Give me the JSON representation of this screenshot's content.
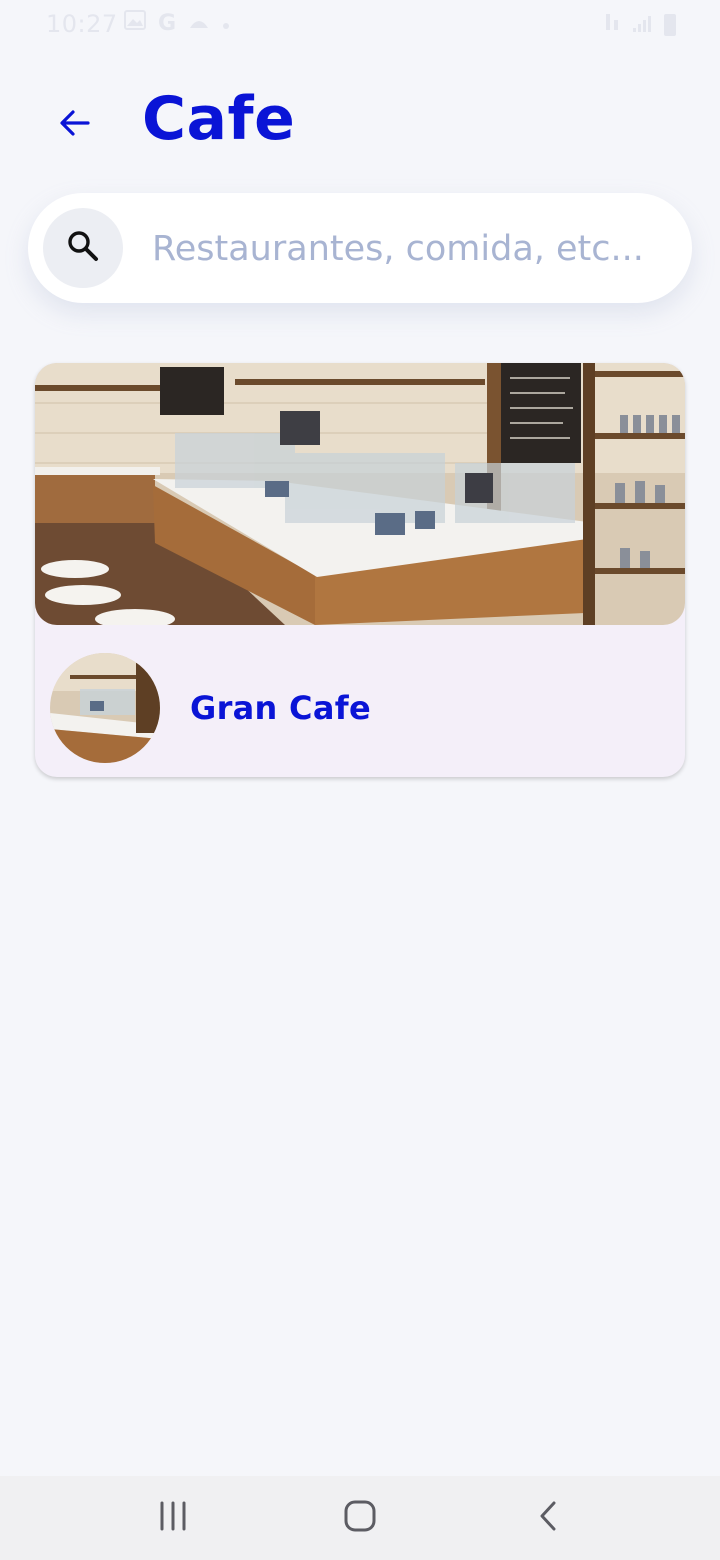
{
  "status_bar": {
    "time": "10:27",
    "left_icons": [
      "gallery-icon",
      "google-icon",
      "weather-icon",
      "dot-icon"
    ],
    "right_icons": [
      "wifi-icon",
      "signal-icon",
      "battery-icon"
    ]
  },
  "header": {
    "back_icon": "arrow-left-icon",
    "title": "Cafe"
  },
  "search": {
    "icon": "search-icon",
    "placeholder": "Restaurantes, comida, etc..."
  },
  "results": [
    {
      "name": "Gran Cafe",
      "image": "cafe-interior-photo",
      "avatar": "cafe-interior-thumbnail"
    }
  ],
  "nav_bar": {
    "recents_icon": "recents-icon",
    "home_icon": "home-icon",
    "back_icon": "back-chevron-icon"
  },
  "colors": {
    "accent": "#0a14d6",
    "background": "#f5f6fa",
    "card_background": "#f4eff9",
    "placeholder": "#a8b4d2"
  }
}
